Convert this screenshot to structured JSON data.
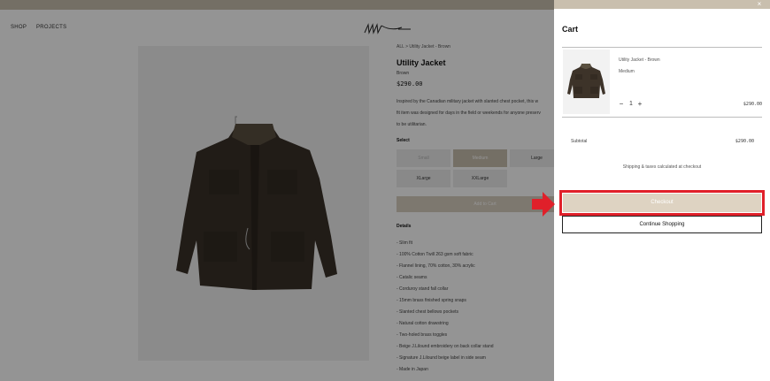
{
  "nav": {
    "shop": "SHOP",
    "projects": "PROJECTS"
  },
  "breadcrumb": "ALL > Utility Jacket - Brown",
  "product": {
    "title": "Utility Jacket",
    "color": "Brown",
    "price": "$290.00",
    "description": [
      "Inspired by the Canadian military jacket with slanted chest pocket, this w",
      "fit item was designed for days in the field or weekends for anyone preserv",
      "to be utilitarian."
    ],
    "select_label": "Select",
    "sizes": [
      "Small",
      "Medium",
      "Large",
      "XLarge",
      "XXLarge"
    ],
    "add_to_cart": "Add to Cart",
    "details_title": "Details",
    "details": [
      "- Slim fit",
      "- 100% Cotton Twill 263 gsm soft fabric",
      "- Flannel lining, 70% cotton, 30% acrylic",
      "- Catalic seams",
      "- Corduroy stand fall collar",
      "- 15mm brass finished spring snaps",
      "- Slanted chest bellows pockets",
      "- Natural cotton drawstring",
      "- Two-holed brass toggles",
      "- Beige J.Lilound embroidery on back collar stand",
      "- Signature J.Lilound beige label in side seam",
      "- Made in Japan"
    ]
  },
  "cart": {
    "title": "Cart",
    "close_glyph": "×",
    "item": {
      "name": "Utility Jacket - Brown",
      "variant": "Medium",
      "qty": "1",
      "minus": "−",
      "plus": "+",
      "price": "$290.00"
    },
    "subtotal_label": "Subtotal",
    "subtotal_value": "$290.00",
    "shipping_note": "Shipping & taxes calculated at checkout",
    "checkout": "Checkout",
    "continue": "Continue Shopping"
  },
  "colors": {
    "accent": "#c9bfae",
    "checkout_bg": "#ded3c2",
    "highlight": "#e0202a",
    "jacket": "#3a3128"
  },
  "icons": {
    "close": "close-icon",
    "arrow": "right-arrow-icon",
    "logo": "brand-logo"
  }
}
